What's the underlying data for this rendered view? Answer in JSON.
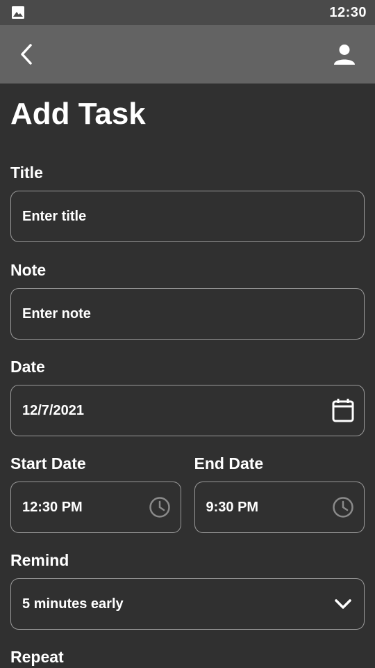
{
  "status_bar": {
    "time": "12:30",
    "left_icon": "image-icon"
  },
  "app_bar": {
    "back_icon": "chevron-left-icon",
    "profile_icon": "person-icon"
  },
  "page": {
    "title": "Add Task"
  },
  "form": {
    "title": {
      "label": "Title",
      "placeholder": "Enter title",
      "value": ""
    },
    "note": {
      "label": "Note",
      "placeholder": "Enter note",
      "value": ""
    },
    "date": {
      "label": "Date",
      "value": "12/7/2021",
      "icon": "calendar-icon"
    },
    "start_date": {
      "label": "Start Date",
      "value": "12:30 PM",
      "icon": "clock-icon"
    },
    "end_date": {
      "label": "End Date",
      "value": "9:30 PM",
      "icon": "clock-icon"
    },
    "remind": {
      "label": "Remind",
      "value": "5 minutes early",
      "icon": "chevron-down-icon"
    },
    "repeat": {
      "label": "Repeat"
    }
  },
  "colors": {
    "background": "#303030",
    "app_bar": "#636363",
    "status_bar": "#4a4a4a",
    "border": "#9a9a9a",
    "text": "#ffffff",
    "icon_muted": "#8a8a8a"
  }
}
